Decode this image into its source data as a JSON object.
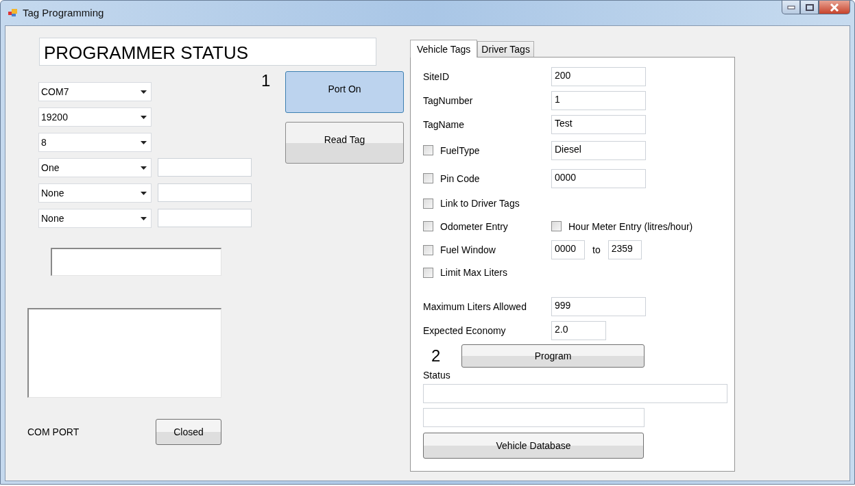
{
  "window": {
    "title": "Tag Programming"
  },
  "status_title": "PROGRAMMER STATUS",
  "serial_settings": [
    {
      "kind": "combo",
      "value": "COM7"
    },
    {
      "kind": "combo",
      "value": "19200"
    },
    {
      "kind": "combo",
      "value": "8"
    },
    {
      "kind": "combo_field",
      "value": "One"
    },
    {
      "kind": "combo_field",
      "value": "None"
    },
    {
      "kind": "combo_field",
      "value": "None"
    }
  ],
  "step_1": "1",
  "port_buttons": [
    {
      "label": "Port On",
      "highlighted": true
    },
    {
      "label": "Read Tag",
      "highlighted": false
    }
  ],
  "com_port": {
    "label": "COM PORT",
    "button": "Closed"
  },
  "tabs": [
    {
      "label": "Vehicle Tags",
      "selected": true
    },
    {
      "label": "Driver Tags",
      "selected": false
    }
  ],
  "vehicle_form": [
    {
      "kind": "field",
      "label": "SiteID",
      "value": "200"
    },
    {
      "kind": "field",
      "label": "TagNumber",
      "value": "1"
    },
    {
      "kind": "field",
      "label": "TagName",
      "value": "Test"
    },
    {
      "kind": "check_field",
      "label": "FuelType",
      "checked": false,
      "value": "Diesel"
    },
    {
      "kind": "check_field",
      "label": "Pin Code",
      "checked": false,
      "value": "0000"
    },
    {
      "kind": "check",
      "label": "Link to Driver Tags",
      "checked": false
    },
    {
      "kind": "check_pair",
      "label": "Odometer Entry",
      "checked": false,
      "label_2": "Hour Meter Entry (litres/hour)",
      "checked_2": false
    },
    {
      "kind": "check_range",
      "label": "Fuel Window",
      "checked": false,
      "from": "0000",
      "separator": "to",
      "to": "2359"
    },
    {
      "kind": "check",
      "label": "Limit Max Liters",
      "checked": false
    },
    {
      "kind": "field",
      "label": "Maximum Liters Allowed",
      "value": "999"
    },
    {
      "kind": "field_short",
      "label": "Expected Economy",
      "value": "2.0"
    }
  ],
  "step_2": "2",
  "program_button": "Program",
  "status_label": "Status",
  "database_button": "Vehicle Database"
}
